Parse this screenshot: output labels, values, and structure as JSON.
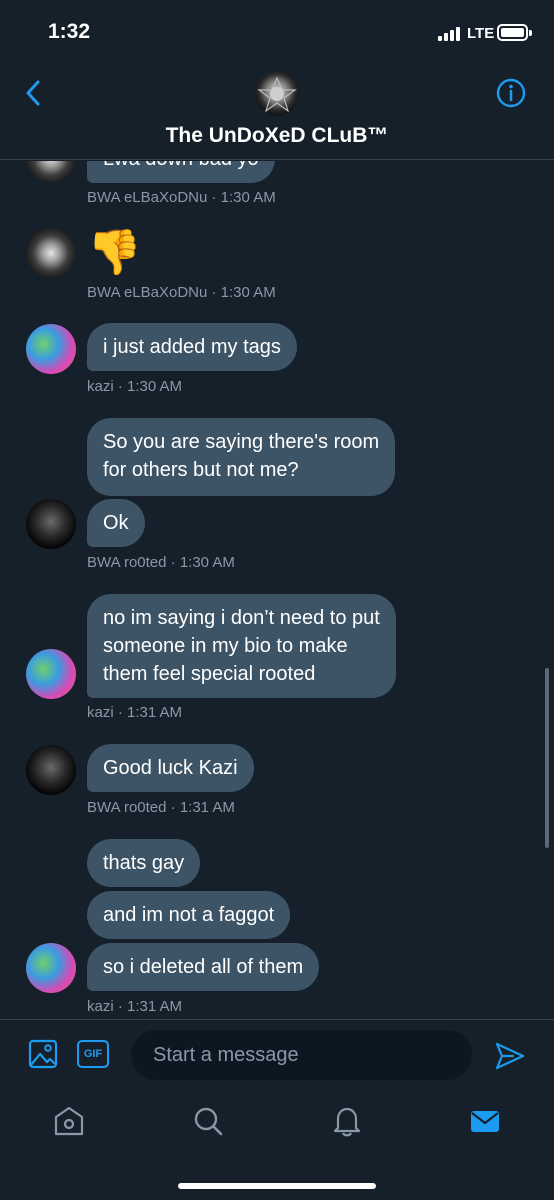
{
  "status_bar": {
    "time": "1:32",
    "network": "LTE"
  },
  "header": {
    "title": "The UnDoXeD CLuB™"
  },
  "messages": [
    {
      "partial_text": "Lwa down bad yo",
      "meta": "BWA eLBaXoDNu · 1:30 AM"
    },
    {
      "emoji": "👎",
      "meta": "BWA eLBaXoDNu · 1:30 AM"
    },
    {
      "text": "i just added my tags",
      "meta": "kazi · 1:30 AM"
    },
    {
      "text_lines": [
        "So you are saying there's room",
        "for others but not me?"
      ],
      "text2": "Ok",
      "meta": "BWA ro0ted · 1:30 AM"
    },
    {
      "text_lines": [
        "no im saying i don’t need to put",
        "someone in my bio to make",
        "them feel special rooted"
      ],
      "meta": "kazi · 1:31 AM"
    },
    {
      "text": "Good luck Kazi",
      "meta": "BWA ro0ted · 1:31 AM"
    },
    {
      "text1": "thats gay",
      "text2": "and im not a faggot",
      "text3": "so i deleted all of them",
      "meta": "kazi · 1:31 AM"
    }
  ],
  "composer": {
    "placeholder": "Start a message",
    "gif_label": "GIF"
  },
  "colors": {
    "background": "#15202b",
    "bubble": "#3d5466",
    "accent": "#1d9bf0",
    "meta_text": "#8899a6"
  },
  "icons": {
    "back": "chevron-left-icon",
    "info": "info-icon",
    "media": "image-icon",
    "gif": "gif-icon",
    "send": "send-icon",
    "tabs": [
      "home-icon",
      "search-icon",
      "bell-icon",
      "mail-icon"
    ]
  }
}
